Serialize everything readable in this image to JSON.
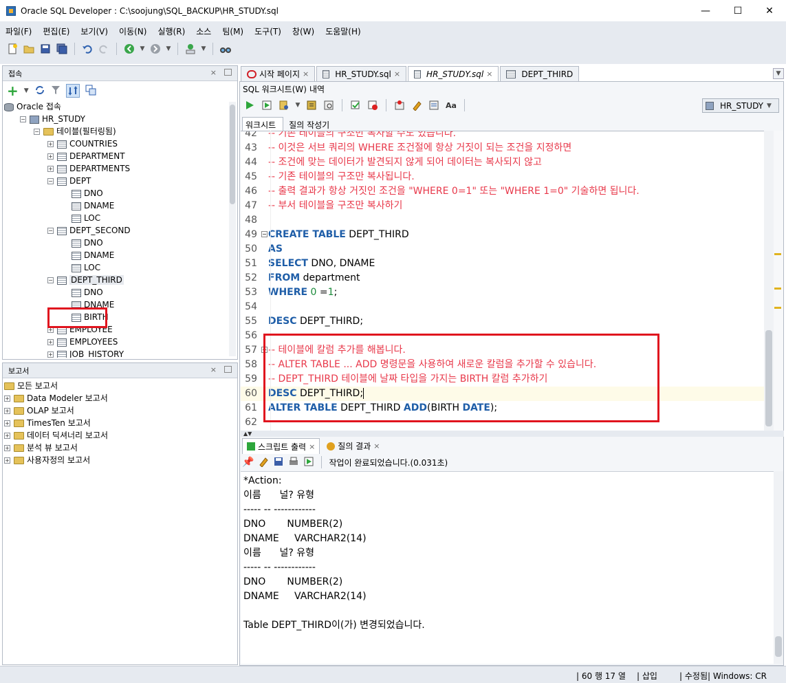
{
  "window": {
    "title": "Oracle SQL Developer : C:\\soojung\\SQL_BACKUP\\HR_STUDY.sql",
    "minimize": "—",
    "maximize": "☐",
    "close": "✕"
  },
  "menu": [
    "파일(F)",
    "편집(E)",
    "보기(V)",
    "이동(N)",
    "실행(R)",
    "소스",
    "팀(M)",
    "도구(T)",
    "창(W)",
    "도움말(H)"
  ],
  "connections_panel": {
    "title": "접속",
    "tree": [
      {
        "label": "Oracle 접속",
        "level": 0,
        "icon": "database",
        "exp": ""
      },
      {
        "label": "HR_STUDY",
        "level": 1,
        "icon": "connection",
        "exp": "−"
      },
      {
        "label": "테이블(필터링됨)",
        "level": 2,
        "icon": "folder",
        "exp": "−"
      },
      {
        "label": "COUNTRIES",
        "level": 3,
        "icon": "table",
        "exp": "+"
      },
      {
        "label": "DEPARTMENT",
        "level": 3,
        "icon": "table",
        "exp": "+"
      },
      {
        "label": "DEPARTMENTS",
        "level": 3,
        "icon": "table",
        "exp": "+"
      },
      {
        "label": "DEPT",
        "level": 3,
        "icon": "table",
        "exp": "−"
      },
      {
        "label": "DNO",
        "level": 4,
        "icon": "column",
        "exp": ""
      },
      {
        "label": "DNAME",
        "level": 4,
        "icon": "column",
        "exp": ""
      },
      {
        "label": "LOC",
        "level": 4,
        "icon": "column",
        "exp": ""
      },
      {
        "label": "DEPT_SECOND",
        "level": 3,
        "icon": "table",
        "exp": "−"
      },
      {
        "label": "DNO",
        "level": 4,
        "icon": "column",
        "exp": ""
      },
      {
        "label": "DNAME",
        "level": 4,
        "icon": "column",
        "exp": ""
      },
      {
        "label": "LOC",
        "level": 4,
        "icon": "column",
        "exp": ""
      },
      {
        "label": "DEPT_THIRD",
        "level": 3,
        "icon": "table",
        "exp": "−",
        "selected": true
      },
      {
        "label": "DNO",
        "level": 4,
        "icon": "column",
        "exp": ""
      },
      {
        "label": "DNAME",
        "level": 4,
        "icon": "column",
        "exp": ""
      },
      {
        "label": "BIRTH",
        "level": 4,
        "icon": "column",
        "exp": ""
      },
      {
        "label": "EMPLOYEE",
        "level": 3,
        "icon": "table",
        "exp": "+"
      },
      {
        "label": "EMPLOYEES",
        "level": 3,
        "icon": "table",
        "exp": "+"
      },
      {
        "label": "JOB_HISTORY",
        "level": 3,
        "icon": "table",
        "exp": "+"
      }
    ]
  },
  "reports_panel": {
    "title": "보고서",
    "items": [
      "모든 보고서",
      "Data Modeler 보고서",
      "OLAP 보고서",
      "TimesTen 보고서",
      "데이터 딕셔너리 보고서",
      "분석 뷰 보고서",
      "사용자정의 보고서"
    ]
  },
  "editor_tabs": [
    "시작 페이지",
    "HR_STUDY.sql",
    "HR_STUDY.sql",
    "DEPT_THIRD"
  ],
  "subtabs": [
    "SQL 워크시트(W)",
    "내역"
  ],
  "connection_selector": "HR_STUDY",
  "worksheet_tabs": [
    "워크시트",
    "질의 작성기"
  ],
  "code_lines": [
    {
      "n": "42",
      "segs": [
        {
          "t": "-- 기존 테이블의 구조만 복사할 수도 있습니다.",
          "c": "cm"
        }
      ]
    },
    {
      "n": "43",
      "segs": [
        {
          "t": "-- 이것은 서브 쿼리의 WHERE 조건절에 항상 거짓이 되는 조건을 지정하면",
          "c": "cm"
        }
      ]
    },
    {
      "n": "44",
      "segs": [
        {
          "t": "-- 조건에 맞는 데이터가 발견되지 않게 되어 데이터는 복사되지 않고",
          "c": "cm"
        }
      ]
    },
    {
      "n": "45",
      "segs": [
        {
          "t": "-- 기존 테이블의 구조만 복사됩니다.",
          "c": "cm"
        }
      ]
    },
    {
      "n": "46",
      "segs": [
        {
          "t": "-- 출력 결과가 항상 거짓인 조건을 \"WHERE 0=1\" 또는 \"WHERE 1=0\" 기술하면 됩니다.",
          "c": "cm"
        }
      ]
    },
    {
      "n": "47",
      "segs": [
        {
          "t": "-- 부서 테이블을 구조만 복사하기",
          "c": "cm"
        }
      ]
    },
    {
      "n": "48",
      "segs": []
    },
    {
      "n": "49",
      "fold": true,
      "segs": [
        {
          "t": "CREATE TABLE",
          "c": "kw"
        },
        {
          "t": " DEPT_THIRD",
          "c": ""
        }
      ]
    },
    {
      "n": "50",
      "segs": [
        {
          "t": "AS",
          "c": "kw"
        }
      ]
    },
    {
      "n": "51",
      "segs": [
        {
          "t": "SELECT",
          "c": "kw"
        },
        {
          "t": " DNO, DNAME",
          "c": ""
        }
      ]
    },
    {
      "n": "52",
      "segs": [
        {
          "t": "FROM",
          "c": "kw"
        },
        {
          "t": " department",
          "c": ""
        }
      ]
    },
    {
      "n": "53",
      "segs": [
        {
          "t": "WHERE",
          "c": "kw"
        },
        {
          "t": " ",
          "c": ""
        },
        {
          "t": "0",
          "c": "num"
        },
        {
          "t": " =",
          "c": ""
        },
        {
          "t": "1",
          "c": "num"
        },
        {
          "t": ";",
          "c": ""
        }
      ]
    },
    {
      "n": "54",
      "segs": []
    },
    {
      "n": "55",
      "segs": [
        {
          "t": "DESC",
          "c": "kw"
        },
        {
          "t": " DEPT_THIRD;",
          "c": ""
        }
      ]
    },
    {
      "n": "56",
      "segs": []
    },
    {
      "n": "57",
      "fold": true,
      "segs": [
        {
          "t": "-- 테이블에 칼럼 추가를 해봅니다.",
          "c": "cm"
        }
      ]
    },
    {
      "n": "58",
      "segs": [
        {
          "t": "-- ALTER TABLE ... ADD 명령문을 사용하여 새로운 칼럼을 추가할 수 있습니다.",
          "c": "cm"
        }
      ]
    },
    {
      "n": "59",
      "segs": [
        {
          "t": "-- DEPT_THIRD 테이블에 날짜 타입을 가지는 BIRTH 칼럼 추가하기",
          "c": "cm"
        }
      ]
    },
    {
      "n": "60",
      "current": true,
      "segs": [
        {
          "t": "DESC",
          "c": "kw"
        },
        {
          "t": " DEPT_THIRD;",
          "c": ""
        }
      ]
    },
    {
      "n": "61",
      "segs": [
        {
          "t": "ALTER TABLE",
          "c": "kw"
        },
        {
          "t": " DEPT_THIRD ",
          "c": ""
        },
        {
          "t": "ADD",
          "c": "kw"
        },
        {
          "t": "(BIRTH ",
          "c": ""
        },
        {
          "t": "DATE",
          "c": "kw"
        },
        {
          "t": ");",
          "c": ""
        }
      ]
    },
    {
      "n": "62",
      "segs": []
    }
  ],
  "output_tabs": [
    "스크립트 출력",
    "질의 결과"
  ],
  "output_status": "작업이 완료되었습니다.(0.031초)",
  "output_lines": [
    "*Action:",
    "이름      널? 유형",
    "----- -- ------------",
    "DNO       NUMBER(2)",
    "DNAME     VARCHAR2(14)",
    "이름      널? 유형",
    "----- -- ------------",
    "DNO       NUMBER(2)",
    "DNAME     VARCHAR2(14)",
    "",
    "Table DEPT_THIRD이(가) 변경되었습니다."
  ],
  "status": {
    "position": "60 행 17 열",
    "mode": "삽입",
    "modified": "수정됨",
    "platform": "Windows: CR"
  },
  "colors": {
    "comment": "#e8384a",
    "keyword": "#1f5ea8",
    "number": "#1a8a3a",
    "highlight_box": "#e0141e",
    "current_line": "#fefbe8"
  }
}
